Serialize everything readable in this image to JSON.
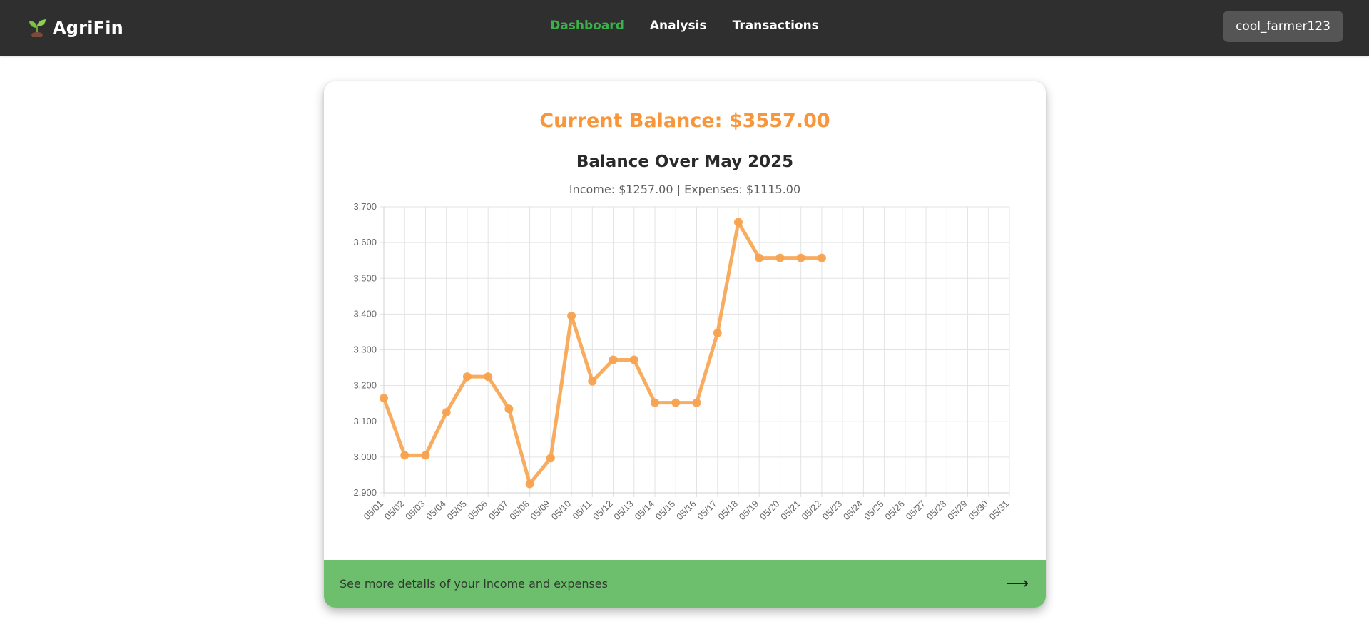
{
  "brand": {
    "name": "AgriFin",
    "icon": "seedling-icon"
  },
  "nav": {
    "links": [
      {
        "label": "Dashboard",
        "active": true
      },
      {
        "label": "Analysis",
        "active": false
      },
      {
        "label": "Transactions",
        "active": false
      }
    ],
    "user": "cool_farmer123"
  },
  "card": {
    "balance_text": "Current Balance: $3557.00",
    "footer_link": "See more details of your income and expenses",
    "footer_arrow": "⟶"
  },
  "colors": {
    "navbar": "#2f2f2f",
    "active_nav": "#3cb04a",
    "accent_orange": "#f7963a",
    "footer_green": "#6dbf6d"
  },
  "chart_data": {
    "type": "line",
    "title": "Balance Over May 2025",
    "subtitle": "Income: $1257.00 | Expenses: $1115.00",
    "ylim": [
      2900,
      3700
    ],
    "yticks": [
      2900,
      3000,
      3100,
      3200,
      3300,
      3400,
      3500,
      3600,
      3700
    ],
    "ytick_labels": [
      "2,900",
      "3,000",
      "3,100",
      "3,200",
      "3,300",
      "3,400",
      "3,500",
      "3,600",
      "3,700"
    ],
    "grid": true,
    "categories": [
      "05/01",
      "05/02",
      "05/03",
      "05/04",
      "05/05",
      "05/06",
      "05/07",
      "05/08",
      "05/09",
      "05/10",
      "05/11",
      "05/12",
      "05/13",
      "05/14",
      "05/15",
      "05/16",
      "05/17",
      "05/18",
      "05/19",
      "05/20",
      "05/21",
      "05/22",
      "05/23",
      "05/24",
      "05/25",
      "05/26",
      "05/27",
      "05/28",
      "05/29",
      "05/30",
      "05/31"
    ],
    "series": [
      {
        "color": "#f7a34f",
        "values": [
          3165,
          3005,
          3005,
          3125,
          3225,
          3225,
          3135,
          2925,
          2997,
          3395,
          3212,
          3272,
          3272,
          3152,
          3152,
          3152,
          3347,
          3657,
          3557,
          3557,
          3557,
          3557
        ]
      }
    ]
  }
}
